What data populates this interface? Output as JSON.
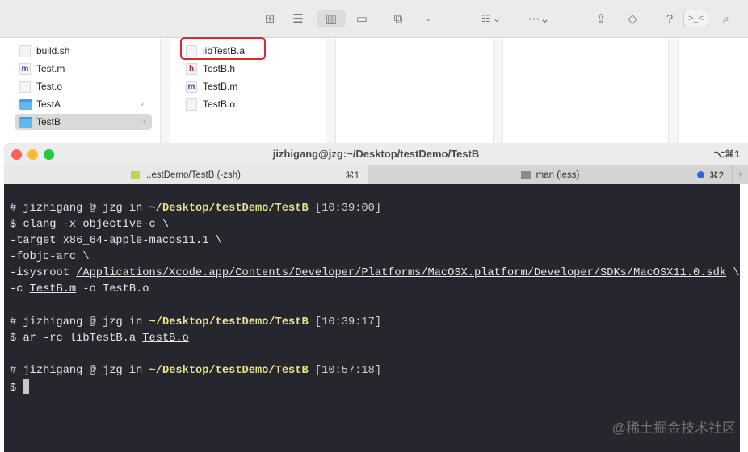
{
  "finder": {
    "toolbar_icons": [
      "icon-view-icon",
      "list-view-icon",
      "column-view-icon",
      "gallery-view-icon",
      "quick-action-icon",
      "chevron-down-icon",
      "group-icon",
      "more-icon",
      "share-icon",
      "tag-icon",
      "help-icon",
      "terminal-icon",
      "search-icon"
    ],
    "help_label": "?",
    "column1": [
      {
        "name": "build.sh",
        "type": "script"
      },
      {
        "name": "Test.m",
        "type": "m"
      },
      {
        "name": "Test.o",
        "type": "doc"
      },
      {
        "name": "TestA",
        "type": "folder"
      },
      {
        "name": "TestB",
        "type": "folder",
        "selected": true
      }
    ],
    "column2": [
      {
        "name": "libTestB.a",
        "type": "doc",
        "highlighted": true
      },
      {
        "name": "TestB.h",
        "type": "h"
      },
      {
        "name": "TestB.m",
        "type": "m"
      },
      {
        "name": "TestB.o",
        "type": "doc"
      }
    ]
  },
  "terminal": {
    "title": "jizhigang@jzg:~/Desktop/testDemo/TestB",
    "title_shortcut": "⌥⌘1",
    "tabs": [
      {
        "label": "..estDemo/TestB (-zsh)",
        "shortcut": "⌘1",
        "active": true
      },
      {
        "label": "man (less)",
        "shortcut": "⌘2",
        "active": false
      }
    ],
    "prompt1": {
      "user": "jizhigang",
      "host": "jzg",
      "path": "~/Desktop/testDemo/TestB",
      "time": "[10:39:00]"
    },
    "cmd1": [
      "clang -x objective-c \\",
      "-target x86_64-apple-macos11.1 \\",
      "-fobjc-arc \\"
    ],
    "cmd1_isysroot_flag": "-isysroot ",
    "cmd1_isysroot_path": "/Applications/Xcode.app/Contents/Developer/Platforms/MacOSX.platform/Developer/SDKs/MacOSX11.0.sdk",
    "cmd1_c_flag": "-c ",
    "cmd1_src": "TestB.m",
    "cmd1_out": " -o TestB.o",
    "prompt2": {
      "user": "jizhigang",
      "host": "jzg",
      "path": "~/Desktop/testDemo/TestB",
      "time": "[10:39:17]"
    },
    "cmd2": "ar -rc libTestB.a ",
    "cmd2_file": "TestB.o",
    "prompt3": {
      "user": "jizhigang",
      "host": "jzg",
      "path": "~/Desktop/testDemo/TestB",
      "time": "[10:57:18]"
    },
    "watermark": "@稀土掘金技术社区"
  },
  "colors": {
    "highlight": "#e3262a",
    "path": "#e4e48c",
    "terminal_bg": "#26262e"
  }
}
